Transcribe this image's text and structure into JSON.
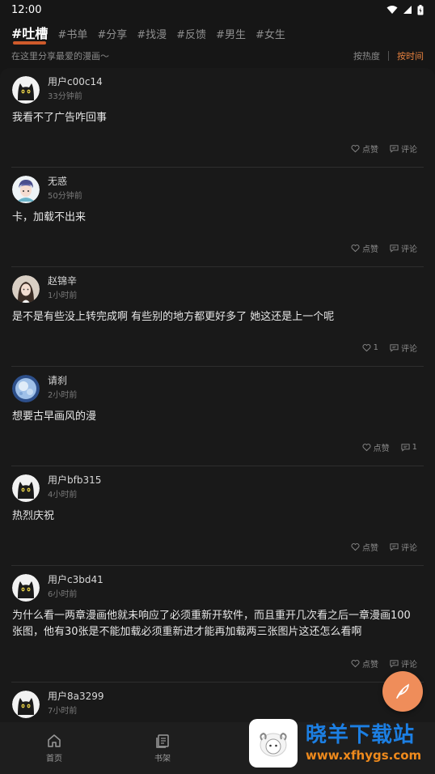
{
  "status_bar": {
    "time": "12:00"
  },
  "tabs": [
    {
      "label": "#吐槽",
      "active": true
    },
    {
      "label": "#书单"
    },
    {
      "label": "#分享"
    },
    {
      "label": "#找漫"
    },
    {
      "label": "#反馈"
    },
    {
      "label": "#男生"
    },
    {
      "label": "#女生"
    }
  ],
  "subtitle": "在这里分享最爱的漫画～",
  "sort": {
    "hot": "按热度",
    "time": "按时间"
  },
  "posts": [
    {
      "user": "用户c00c14",
      "time": "33分钟前",
      "content": "我看不了广告咋回事",
      "like": "点赞",
      "comment": "评论",
      "avatar": "black-cat-avatar"
    },
    {
      "user": "无惑",
      "time": "50分钟前",
      "content": "卡，加载不出来",
      "like": "点赞",
      "comment": "评论",
      "avatar": "anime-avatar"
    },
    {
      "user": "赵锦辛",
      "time": "1小时前",
      "content": "是不是有些没上转完成啊 有些别的地方都更好多了 她这还是上一个呢",
      "like": "1",
      "comment": "评论",
      "avatar": "portrait-avatar"
    },
    {
      "user": "请刹",
      "time": "2小时前",
      "content": "想要古早画风的漫",
      "like": "点赞",
      "comment": "1",
      "avatar": "moon-avatar"
    },
    {
      "user": "用户bfb315",
      "time": "4小时前",
      "content": "热烈庆祝",
      "like": "点赞",
      "comment": "评论",
      "avatar": "black-cat-avatar"
    },
    {
      "user": "用户c3bd41",
      "time": "6小时前",
      "content": "为什么看一两章漫画他就未响应了必须重新开软件，而且重开几次看之后一章漫画100张图，他有30张是不能加载必须重新进才能再加载两三张图片这还怎么看啊",
      "like": "点赞",
      "comment": "评论",
      "avatar": "black-cat-avatar"
    },
    {
      "user": "用户8a3299",
      "time": "7小时前",
      "content": "",
      "like": "",
      "comment": "",
      "avatar": "black-cat-avatar"
    }
  ],
  "bottom_nav": [
    {
      "label": "首页",
      "icon": "home-icon"
    },
    {
      "label": "书架",
      "icon": "bookshelf-icon"
    }
  ],
  "watermark": {
    "title": "晓羊下载站",
    "url": "www.xfhygs.com"
  },
  "colors": {
    "accent": "#e6813f",
    "fab": "#ef8d5a",
    "background": "#191919"
  }
}
